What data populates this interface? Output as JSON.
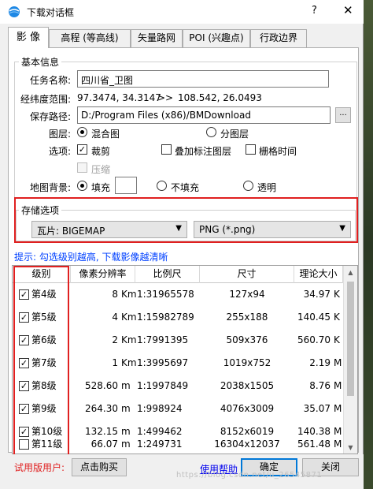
{
  "window": {
    "title": "下载对话框",
    "help_glyph": "?",
    "close_glyph": "✕"
  },
  "tabs": [
    {
      "label": "影 像",
      "active": true
    },
    {
      "label": "高程 (等高线)"
    },
    {
      "label": "矢量路网"
    },
    {
      "label": "POI (兴趣点)"
    },
    {
      "label": "行政边界"
    }
  ],
  "basic_info": {
    "title": "基本信息",
    "task_name_label": "任务名称:",
    "task_name_value": "四川省_卫图",
    "extent_label": "经纬度范围:",
    "extent_from": "97.3474, 34.3147",
    "extent_arrow": ">>",
    "extent_to": "108.542, 26.0493",
    "save_path_label": "保存路径:",
    "save_path_value": "D:/Program Files (x86)/BMDownload",
    "browse_label": "...",
    "layer_label": "图层:",
    "layer_options": [
      "混合图",
      "分图层"
    ],
    "options_label": "选项:",
    "opt_crop": "裁剪",
    "opt_overlay": "叠加标注图层",
    "opt_grid_time": "栅格时间",
    "opt_compress": "压缩",
    "check_mark": "✓",
    "bg_label": "地图背景:",
    "bg_fill": "填充",
    "bg_nofill": "不填充",
    "bg_transparent": "透明"
  },
  "storage": {
    "title": "存储选项",
    "tile_format": "瓦片: BIGEMAP",
    "image_format": "PNG (*.png)",
    "arrow_glyph": "▼"
  },
  "hint": "提示: 勾选级别越高, 下载影像越清晰",
  "table": {
    "headers": [
      "级别",
      "像素分辨率",
      "比例尺",
      "尺寸",
      "理论大小"
    ],
    "rows": [
      {
        "checked": true,
        "level": "第4级",
        "res": "8",
        "res_unit": "Km",
        "scale": "1:31965578",
        "size": "127x94",
        "theory": "34.97",
        "theory_unit": "K"
      },
      {
        "checked": true,
        "level": "第5级",
        "res": "4",
        "res_unit": "Km",
        "scale": "1:15982789",
        "size": "255x188",
        "theory": "140.45",
        "theory_unit": "K"
      },
      {
        "checked": true,
        "level": "第6级",
        "res": "2",
        "res_unit": "Km",
        "scale": "1:7991395",
        "size": "509x376",
        "theory": "560.70",
        "theory_unit": "K"
      },
      {
        "checked": true,
        "level": "第7级",
        "res": "1",
        "res_unit": "Km",
        "scale": "1:3995697",
        "size": "1019x752",
        "theory": "2.19",
        "theory_unit": "M"
      },
      {
        "checked": true,
        "level": "第8级",
        "res": "528.60",
        "res_unit": "m",
        "scale": "1:1997849",
        "size": "2038x1505",
        "theory": "8.76",
        "theory_unit": "M"
      },
      {
        "checked": true,
        "level": "第9级",
        "res": "264.30",
        "res_unit": "m",
        "scale": "1:998924",
        "size": "4076x3009",
        "theory": "35.07",
        "theory_unit": "M"
      },
      {
        "checked": true,
        "level": "第10级",
        "res": "132.15",
        "res_unit": "m",
        "scale": "1:499462",
        "size": "8152x6019",
        "theory": "140.38",
        "theory_unit": "M"
      },
      {
        "checked": false,
        "level": "第11级",
        "res": "66.07",
        "res_unit": "m",
        "scale": "1:249731",
        "size": "16304x12037",
        "theory": "561.48",
        "theory_unit": "M"
      }
    ],
    "scroll_up": "▲",
    "scroll_down": "▼"
  },
  "footer": {
    "trial": "试用版用户:",
    "buy_button": "点击购买",
    "help_link": "使用帮助",
    "ok_button": "确定",
    "close_button": "关闭",
    "watermark": "https://blog.csdn.net/u_26545871"
  },
  "colors": {
    "highlight_red": "#e02020",
    "hint_blue": "#0040ff",
    "link_blue": "#0000ee",
    "accent": "#0078d7"
  }
}
